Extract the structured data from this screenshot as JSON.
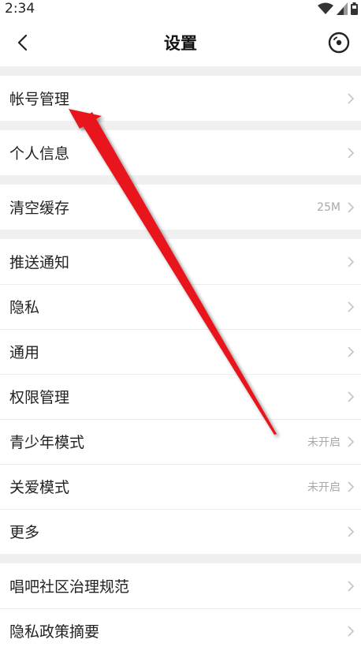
{
  "status_bar": {
    "time": "2:34",
    "icons": [
      "wifi-icon",
      "signal-icon",
      "battery-icon"
    ]
  },
  "nav": {
    "title": "设置",
    "back_icon": "back-arrow-icon",
    "right_icon": "disc-icon"
  },
  "groups": [
    {
      "rows": [
        {
          "name": "account-management",
          "label": "帐号管理",
          "value": ""
        }
      ]
    },
    {
      "rows": [
        {
          "name": "personal-info",
          "label": "个人信息",
          "value": ""
        }
      ]
    },
    {
      "rows": [
        {
          "name": "clear-cache",
          "label": "清空缓存",
          "value": "25M"
        }
      ]
    },
    {
      "rows": [
        {
          "name": "push-notifications",
          "label": "推送通知",
          "value": ""
        },
        {
          "name": "privacy",
          "label": "隐私",
          "value": ""
        },
        {
          "name": "general",
          "label": "通用",
          "value": ""
        },
        {
          "name": "permission-management",
          "label": "权限管理",
          "value": ""
        },
        {
          "name": "teen-mode",
          "label": "青少年模式",
          "value": "未开启"
        },
        {
          "name": "care-mode",
          "label": "关爱模式",
          "value": "未开启"
        },
        {
          "name": "more",
          "label": "更多",
          "value": ""
        }
      ]
    },
    {
      "rows": [
        {
          "name": "community-guidelines",
          "label": "唱吧社区治理规范",
          "value": ""
        },
        {
          "name": "privacy-policy-summary",
          "label": "隐私政策摘要",
          "value": ""
        }
      ]
    }
  ],
  "colors": {
    "background": "#f0f0f0",
    "row_background": "#ffffff",
    "annotation_arrow": "#e8141c",
    "secondary_text": "#a8a8a8",
    "chevron": "#c4c4c4"
  }
}
